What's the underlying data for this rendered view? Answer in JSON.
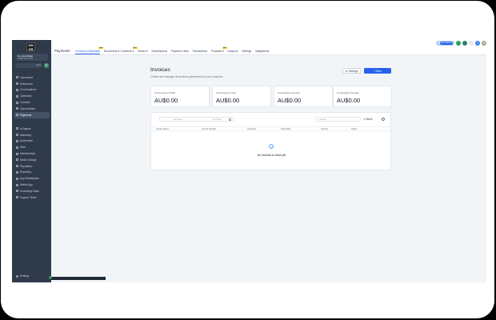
{
  "app": {
    "logo_text": "GH\nCR",
    "account_name": "Go-Get Digital",
    "account_sub": "Global Hub, JPN",
    "search_kbd": "ctrl K",
    "plus": "+"
  },
  "sidebar": {
    "items_top": [
      {
        "label": "Launchpad"
      },
      {
        "label": "Dashboard"
      },
      {
        "label": "Conversations"
      },
      {
        "label": "Calendars"
      },
      {
        "label": "Contacts"
      },
      {
        "label": "Opportunities"
      },
      {
        "label": "Payments",
        "active": true
      }
    ],
    "items_bottom": [
      {
        "label": "AI Agents"
      },
      {
        "label": "Marketing"
      },
      {
        "label": "Automation"
      },
      {
        "label": "Sites"
      },
      {
        "label": "Memberships"
      },
      {
        "label": "Media Storage"
      },
      {
        "label": "Reputation"
      },
      {
        "label": "Reporting"
      },
      {
        "label": "App Marketplace"
      },
      {
        "label": "Mobile App"
      },
      {
        "label": "Knowledge Base"
      },
      {
        "label": "Support Ticket"
      }
    ],
    "settings_label": "Settings"
  },
  "topbar": {
    "page_name": "Payments",
    "tabs": [
      {
        "label": "Invoices & Estimates",
        "active": true,
        "badge": "New"
      },
      {
        "label": "Documents & Contracts ▾",
        "badge": "New"
      },
      {
        "label": "Orders ▾"
      },
      {
        "label": "Subscriptions"
      },
      {
        "label": "Payment Links"
      },
      {
        "label": "Transactions"
      },
      {
        "label": "Products ▾",
        "badge": "New"
      },
      {
        "label": "Coupons"
      },
      {
        "label": "Settings"
      },
      {
        "label": "Integrations"
      }
    ],
    "pill_label": "Get Started",
    "avatars": [
      {
        "text": "",
        "color": "#22a45a"
      },
      {
        "text": "",
        "color": "#2e7d6a"
      },
      {
        "text": "",
        "color": "#e5e7eb"
      },
      {
        "text": "T",
        "color": "#3b82f6"
      },
      {
        "text": "JB",
        "color": "#a3a38a"
      }
    ]
  },
  "main": {
    "title": "Invoices",
    "subtitle": "Create and manage all invoices generated for your business",
    "settings_button": "Settings",
    "new_button": "+ New",
    "cards": [
      {
        "label": "0 Invoice(s) in Draft",
        "value": "AU$0.00"
      },
      {
        "label": "0 Invoice(s) in Due",
        "value": "AU$0.00"
      },
      {
        "label": "0 Invoice(s) received",
        "value": "AU$0.00"
      },
      {
        "label": "0 Invoice(s) Overdue",
        "value": "AU$0.00"
      }
    ],
    "date_start": "Start Date",
    "date_arrow": "→",
    "date_end": "End Date",
    "search_placeholder": "Search",
    "filters_label": "Filters",
    "columns": [
      "Invoice Name",
      "Invoice Number",
      "Customer",
      "Issue Date",
      "Amount",
      "Status"
    ],
    "empty_text": "No invoices to show yet"
  }
}
